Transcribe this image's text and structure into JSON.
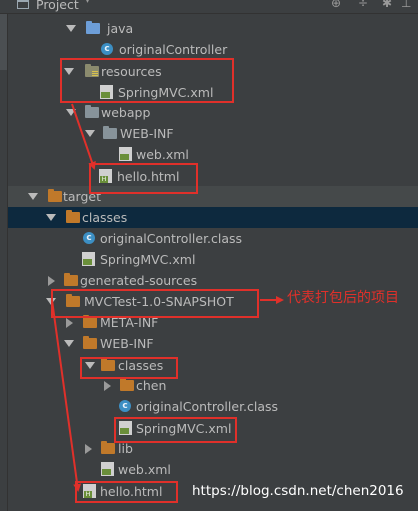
{
  "toolbar": {
    "title": "Project",
    "icons": [
      "project-icon",
      "dropdown-icon",
      "locate-icon",
      "settings-icon",
      "hide-icon"
    ]
  },
  "tree": {
    "java": "java",
    "originalController_src": "originalController",
    "resources": "resources",
    "springmvc_res": "SpringMVC.xml",
    "webapp": "webapp",
    "webinf_src": "WEB-INF",
    "webxml_src": "web.xml",
    "hello_src": "hello.html",
    "target": "target",
    "classes": "classes",
    "originalController_class": "originalController.class",
    "springmvc_target": "SpringMVC.xml",
    "generated": "generated-sources",
    "snapshot": "MVCTest-1.0-SNAPSHOT",
    "metainf": "META-INF",
    "webinf_target": "WEB-INF",
    "classes_inner": "classes",
    "chen": "chen",
    "originalController_inner": "originalController.class",
    "springmvc_inner": "SpringMVC.xml",
    "lib": "lib",
    "webxml_target": "web.xml",
    "hello_target": "hello.html"
  },
  "annotation": "代表打包后的项目",
  "watermark": "https://blog.csdn.net/chen2016",
  "colors": {
    "background": "#3c3f41",
    "selection": "#0d293e",
    "annotation_red": "#e0302a"
  }
}
